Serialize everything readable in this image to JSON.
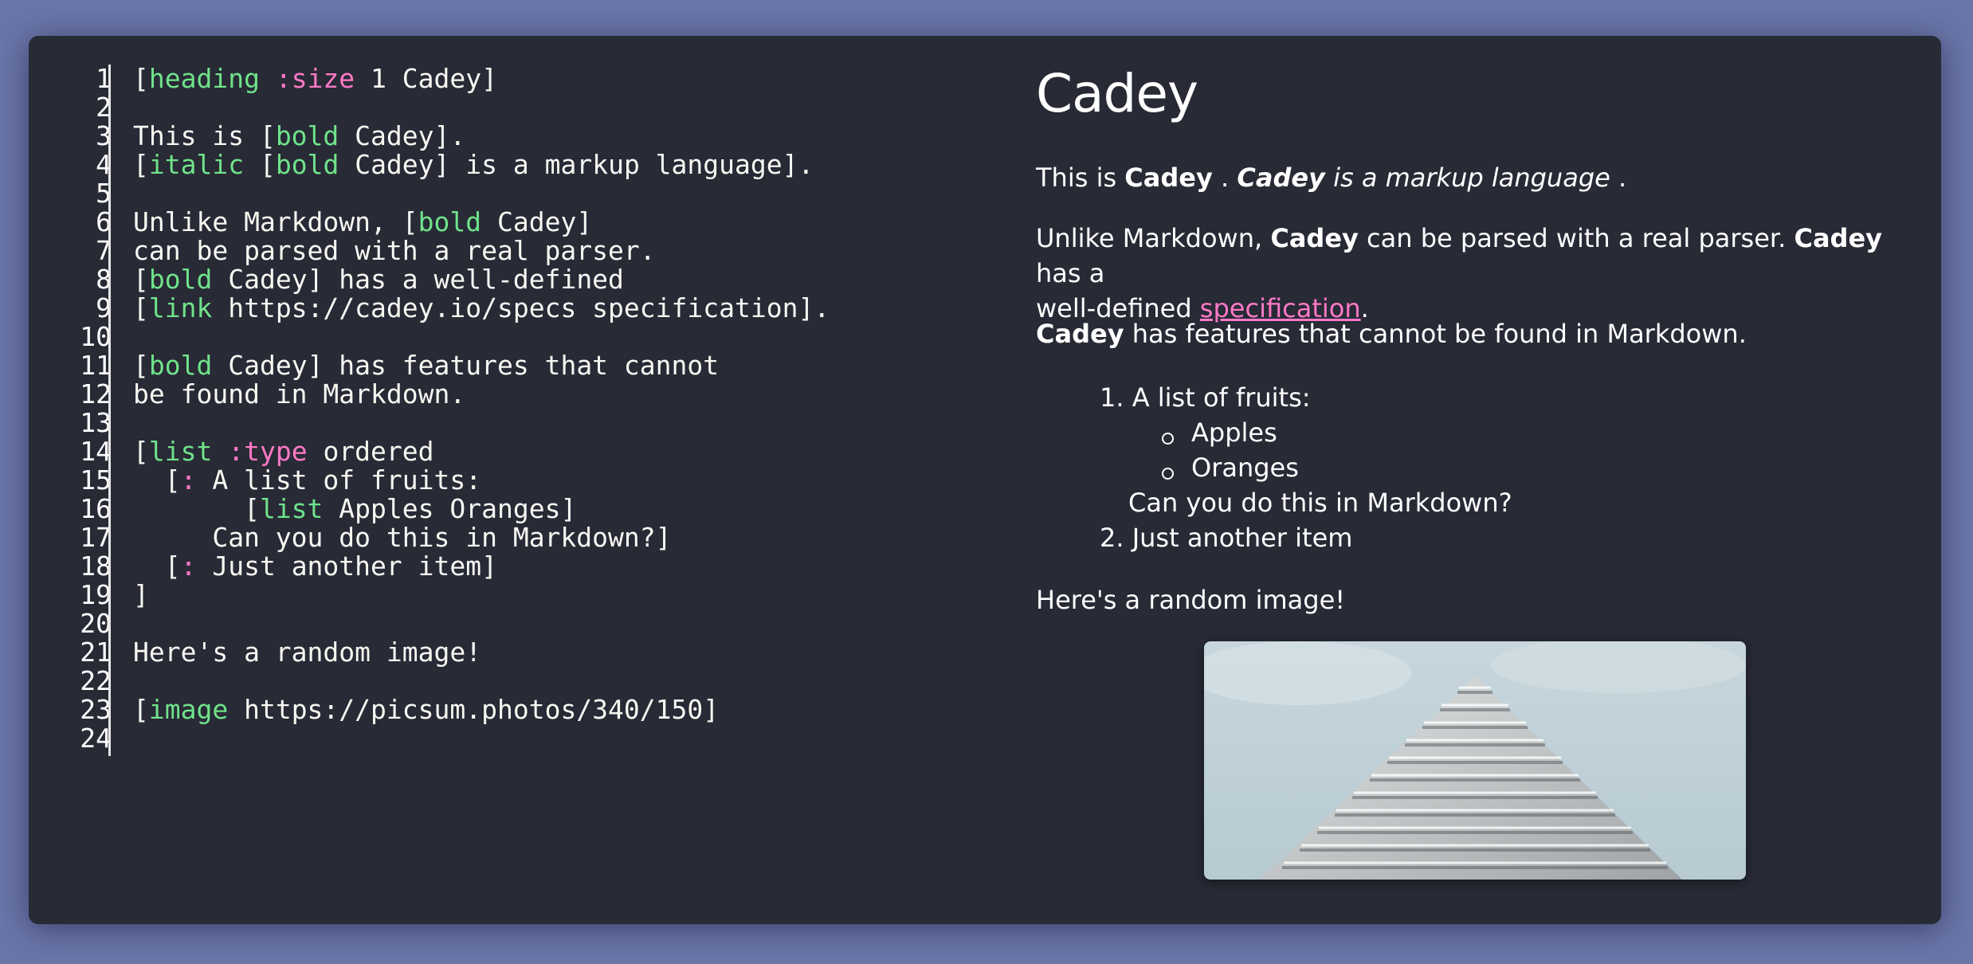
{
  "editor": {
    "line_numbers": [
      "1",
      "2",
      "3",
      "4",
      "5",
      "6",
      "7",
      "8",
      "9",
      "10",
      "11",
      "12",
      "13",
      "14",
      "15",
      "16",
      "17",
      "18",
      "19",
      "20",
      "21",
      "22",
      "23",
      "24"
    ],
    "lines": [
      [
        [
          "[",
          "t"
        ],
        [
          "heading",
          "kw"
        ],
        [
          " ",
          "t"
        ],
        [
          ":size",
          "at"
        ],
        [
          " 1 Cadey]",
          "t"
        ]
      ],
      [],
      [
        [
          "This is [",
          "t"
        ],
        [
          "bold",
          "kw"
        ],
        [
          " Cadey].",
          "t"
        ]
      ],
      [
        [
          "[",
          "t"
        ],
        [
          "italic",
          "kw"
        ],
        [
          " [",
          "t"
        ],
        [
          "bold",
          "kw"
        ],
        [
          " Cadey] is a markup language].",
          "t"
        ]
      ],
      [],
      [
        [
          "Unlike Markdown, [",
          "t"
        ],
        [
          "bold",
          "kw"
        ],
        [
          " Cadey]",
          "t"
        ]
      ],
      [
        [
          "can be parsed with a real parser.",
          "t"
        ]
      ],
      [
        [
          "[",
          "t"
        ],
        [
          "bold",
          "kw"
        ],
        [
          " Cadey] has a well-defined",
          "t"
        ]
      ],
      [
        [
          "[",
          "t"
        ],
        [
          "link",
          "kw"
        ],
        [
          " https://cadey.io/specs specification].",
          "t"
        ]
      ],
      [],
      [
        [
          "[",
          "t"
        ],
        [
          "bold",
          "kw"
        ],
        [
          " Cadey] has features that cannot",
          "t"
        ]
      ],
      [
        [
          "be found in Markdown.",
          "t"
        ]
      ],
      [],
      [
        [
          "[",
          "t"
        ],
        [
          "list",
          "kw"
        ],
        [
          " ",
          "t"
        ],
        [
          ":type",
          "at"
        ],
        [
          " ordered",
          "t"
        ]
      ],
      [
        [
          "  [",
          "t"
        ],
        [
          ":",
          "at"
        ],
        [
          " A list of fruits:",
          "t"
        ]
      ],
      [
        [
          "       [",
          "t"
        ],
        [
          "list",
          "kw"
        ],
        [
          " Apples Oranges]",
          "t"
        ]
      ],
      [
        [
          "     Can you do this in Markdown?]",
          "t"
        ]
      ],
      [
        [
          "  [",
          "t"
        ],
        [
          ":",
          "at"
        ],
        [
          " Just another item]",
          "t"
        ]
      ],
      [
        [
          "]",
          "t"
        ]
      ],
      [],
      [
        [
          "Here's a random image!",
          "t"
        ]
      ],
      [],
      [
        [
          "[",
          "t"
        ],
        [
          "image",
          "kw"
        ],
        [
          " https://picsum.photos/340/150]",
          "t"
        ]
      ],
      []
    ]
  },
  "preview": {
    "title": "Cadey",
    "p1": {
      "a": "This is ",
      "b": "Cadey",
      "c": " . ",
      "d": "Cadey",
      "e": " is a markup language",
      "f": " ."
    },
    "p2": {
      "a": "Unlike Markdown, ",
      "b": "Cadey",
      "c": " can be parsed with a real parser. ",
      "d": "Cadey",
      "e": " has a",
      "f": "well-defined ",
      "link": "specification",
      "g": "."
    },
    "p3": {
      "b": "Cadey",
      "a": " has features that cannot be found in Markdown."
    },
    "list": {
      "item1": "1. A list of fruits:",
      "sub": [
        "Apples",
        "Oranges"
      ],
      "continuation": "Can you do this in Markdown?",
      "item2": "2. Just another item"
    },
    "p4": "Here's a random image!"
  },
  "colors": {
    "background": "#6a76a8",
    "panel": "#282a36",
    "keyword": "#6fe38a",
    "attribute": "#ff79c6",
    "link": "#ff79c6",
    "text": "#f8f8f2"
  }
}
